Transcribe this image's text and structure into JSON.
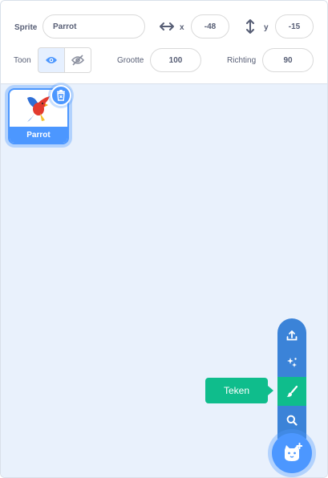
{
  "sprite_info": {
    "sprite_label": "Sprite",
    "sprite_name": "Parrot",
    "x_label": "x",
    "x_value": "-48",
    "y_label": "y",
    "y_value": "-15",
    "show_label": "Toon",
    "size_label": "Grootte",
    "size_value": "100",
    "direction_label": "Richting",
    "direction_value": "90"
  },
  "sprites": [
    {
      "name": "Parrot",
      "selected": true
    }
  ],
  "add_sprite_menu": {
    "items": [
      "upload-icon",
      "surprise-icon",
      "paint-icon",
      "search-icon"
    ],
    "tooltip": "Teken",
    "active_item": "paint-icon"
  },
  "colors": {
    "accent": "#4c97ff",
    "menu": "#3b83d8",
    "active": "#0fbd8c",
    "text": "#575e75"
  }
}
